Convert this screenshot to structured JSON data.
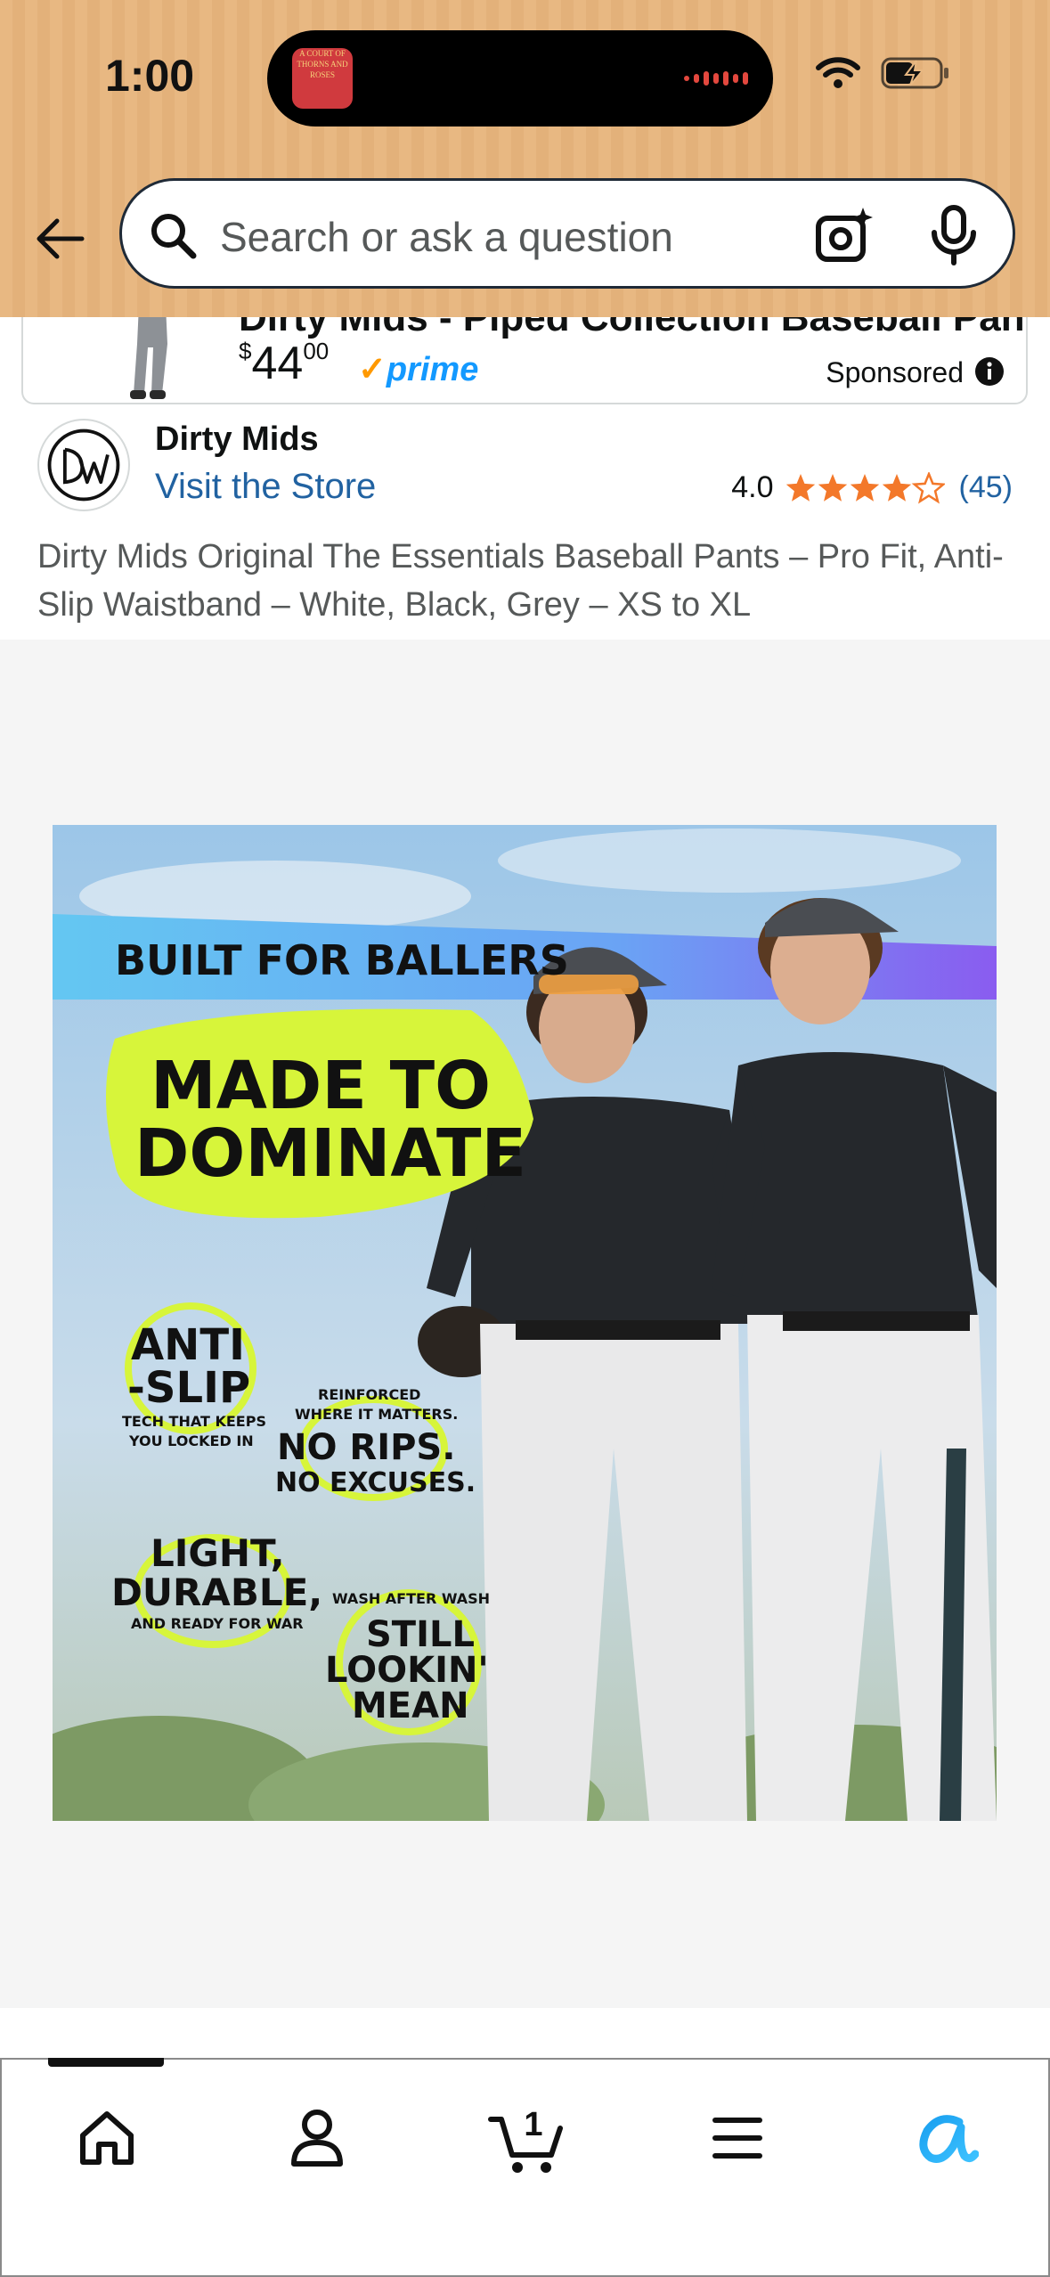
{
  "status_bar": {
    "time": "1:00",
    "island_thumb_text": "A COURT OF THORNS AND ROSES",
    "icons": [
      "wifi-icon",
      "battery-charging-icon"
    ]
  },
  "search": {
    "placeholder": "Search or ask a question",
    "icons": [
      "back-arrow-icon",
      "search-icon",
      "camera-lens-icon",
      "microphone-icon"
    ]
  },
  "sponsored_ad": {
    "title": "Dirty Mids - Piped Collection Baseball Pan...",
    "price_currency": "$",
    "price_whole": "44",
    "price_fraction": "00",
    "prime_label": "prime",
    "sponsored_label": "Sponsored"
  },
  "store": {
    "brand_name": "Dirty Mids",
    "visit_store_label": "Visit the Store",
    "rating_value": "4.0",
    "rating_stars": 4,
    "rating_max": 5,
    "rating_count": "(45)"
  },
  "product": {
    "title": "Dirty Mids Original The Essentials Baseball Pants – Pro Fit, Anti-Slip Waistband – White, Black, Grey – XS to XL"
  },
  "hero_image": {
    "banner": "BUILT FOR BALLERS",
    "headline_1": "MADE TO",
    "headline_2": "DOMINATE",
    "callouts": [
      {
        "big_1": "ANTI",
        "big_2": "-SLIP",
        "small_1": "TECH THAT KEEPS",
        "small_2": "YOU LOCKED IN"
      },
      {
        "small_1": "REINFORCED",
        "small_2": "WHERE IT MATTERS.",
        "big_1": "NO RIPS.",
        "big_2": "NO EXCUSES."
      },
      {
        "big_1": "LIGHT,",
        "big_2": "DURABLE,",
        "small_1": "AND READY FOR WAR"
      },
      {
        "small_1": "WASH AFTER WASH",
        "big_1": "STILL",
        "big_2": "LOOKIN'",
        "big_3": "MEAN"
      }
    ]
  },
  "bottom_nav": {
    "cart_count": "1",
    "items": [
      "home-icon",
      "account-icon",
      "cart-icon",
      "menu-icon",
      "rufus-ai-icon"
    ]
  },
  "colors": {
    "header_bg": "#e8b882",
    "link": "#2162a1",
    "star": "#f3782a",
    "prime_blue": "#1399ff",
    "accent_yellow": "#d7f53a"
  }
}
